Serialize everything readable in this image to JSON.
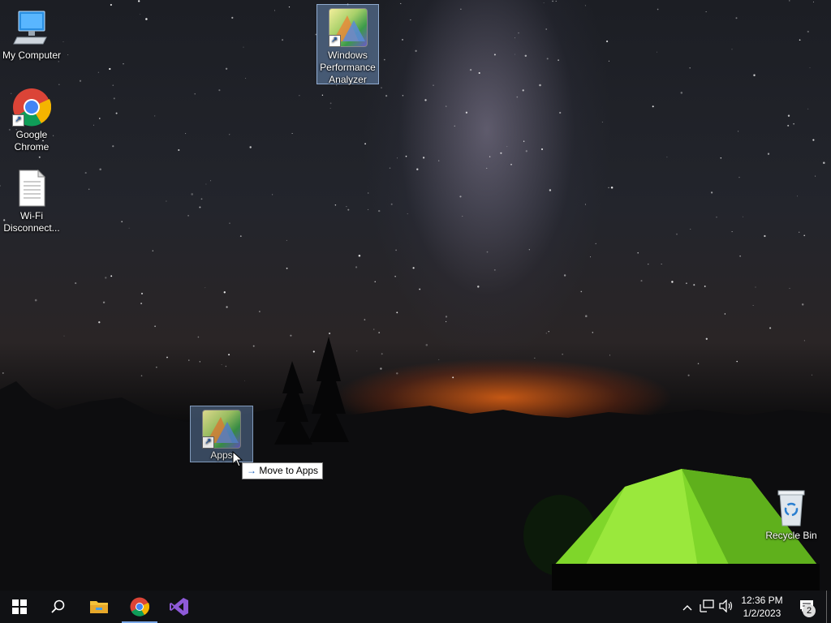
{
  "desktop": {
    "icons": [
      {
        "label": "My Computer"
      },
      {
        "label": "Google Chrome"
      },
      {
        "label": "Wi-Fi Disconnect..."
      },
      {
        "label": "Windows Performance Analyzer"
      },
      {
        "label": "Recycle Bin"
      }
    ],
    "drag_icon_label": "Apps",
    "tooltip": {
      "arrow": "→",
      "text": "Move to Apps"
    }
  },
  "taskbar": {
    "clock": {
      "time": "12:36 PM",
      "date": "1/2/2023"
    },
    "notification_count": "2",
    "colors": {
      "background": "#101114",
      "active_indicator": "#7aa8e8"
    }
  }
}
